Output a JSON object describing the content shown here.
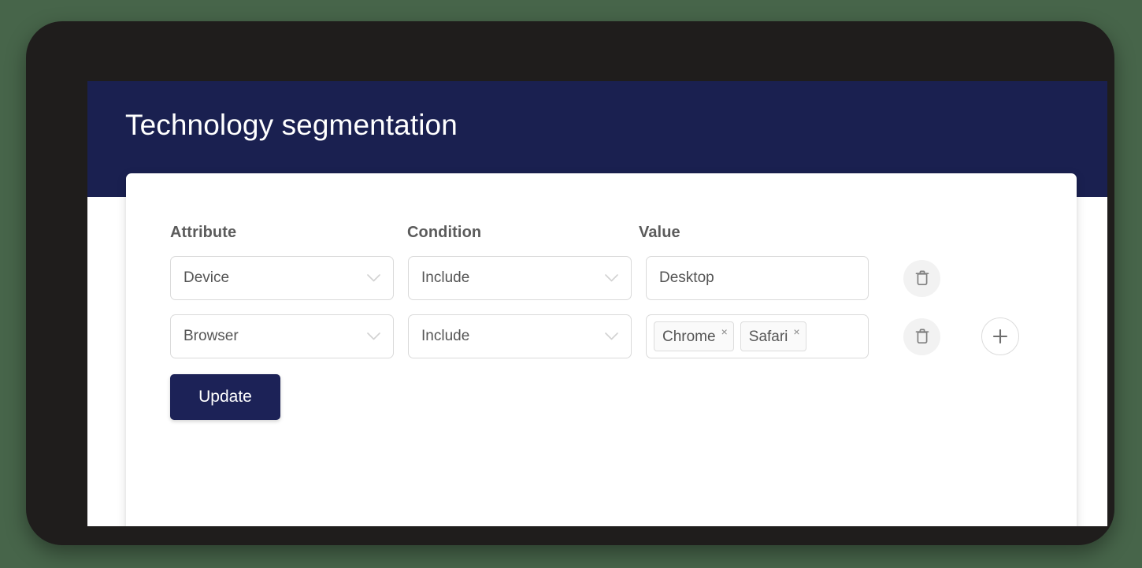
{
  "header": {
    "title": "Technology segmentation",
    "background_color": "#1a2050"
  },
  "colors": {
    "brand_navy": "#1a2050",
    "button_navy": "#1c2257",
    "field_border": "#dadada",
    "page_background": "#47654a",
    "bezel": "#1f1d1c"
  },
  "form": {
    "columns": {
      "attribute": "Attribute",
      "condition": "Condition",
      "value": "Value"
    },
    "rows": [
      {
        "attribute": "Device",
        "condition": "Include",
        "value_text": "Desktop",
        "tags": [],
        "has_add_button": false
      },
      {
        "attribute": "Browser",
        "condition": "Include",
        "value_text": "",
        "tags": [
          "Chrome",
          "Safari"
        ],
        "has_add_button": true
      }
    ],
    "tag_remove_label": "×",
    "submit_label": "Update"
  },
  "icons": {
    "chevron": "chevron-down-icon",
    "trash": "trash-icon",
    "plus": "plus-icon"
  }
}
